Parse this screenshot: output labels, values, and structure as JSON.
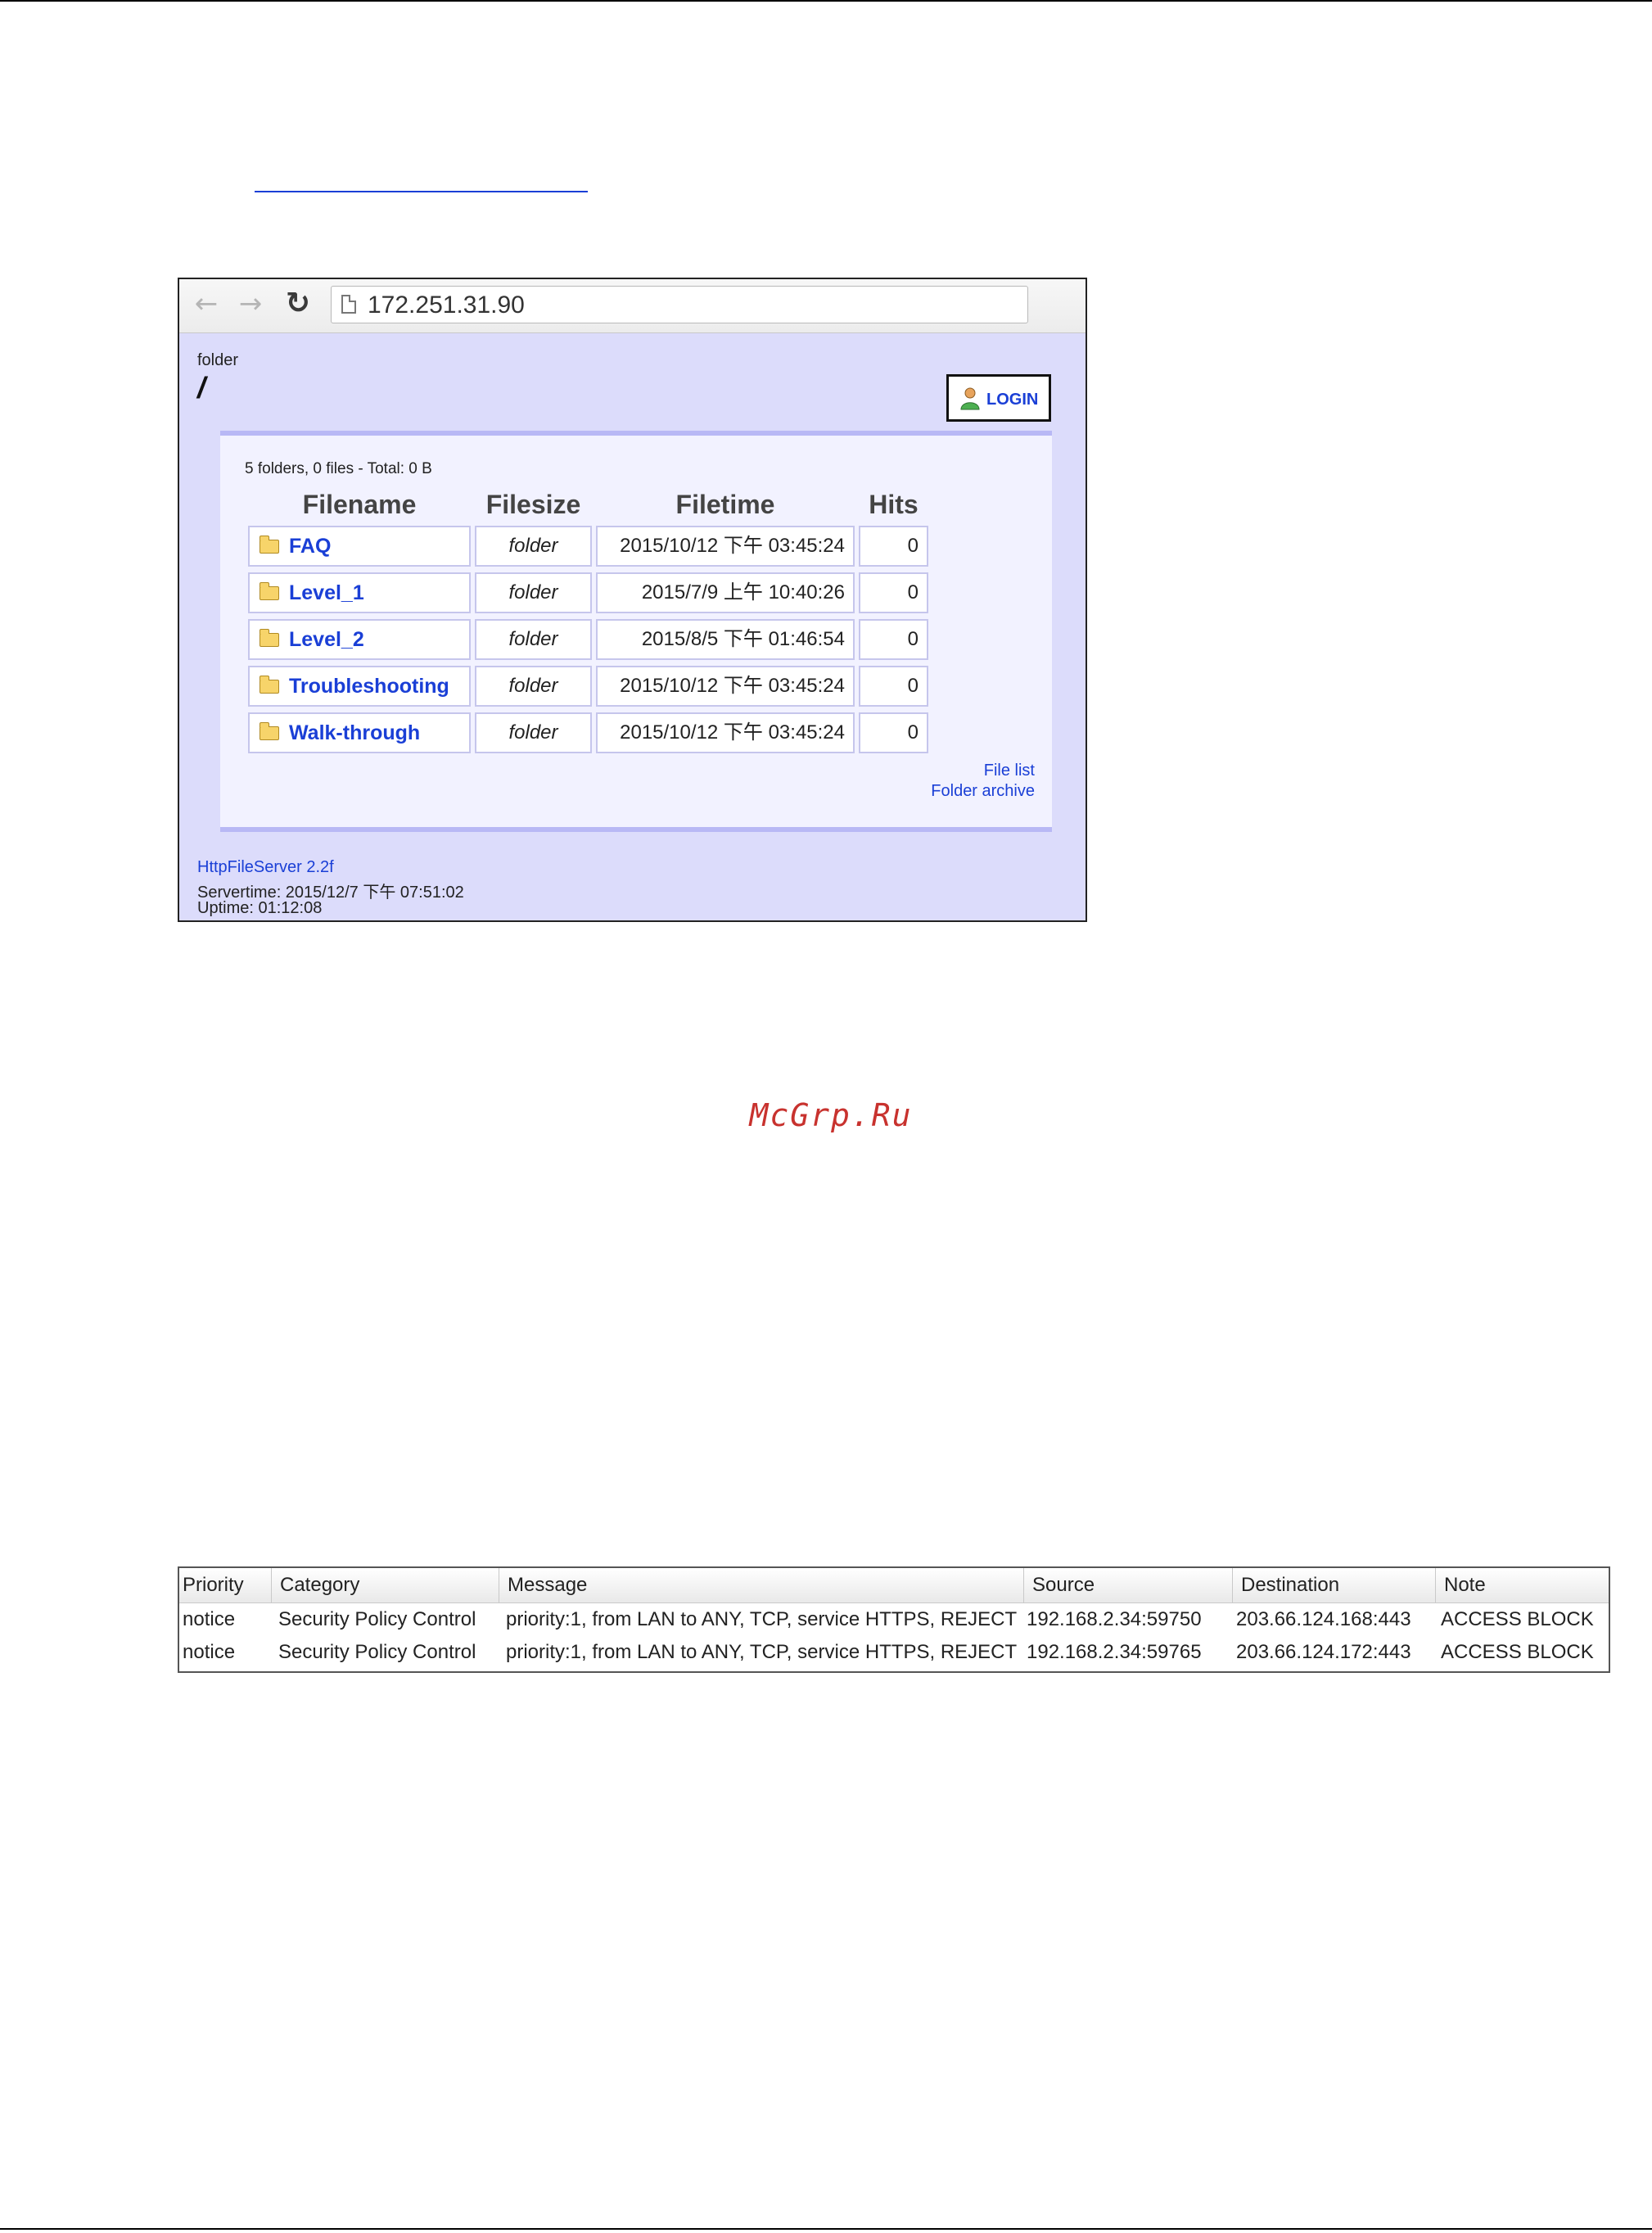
{
  "doc": {
    "watermark": "McGrp.Ru"
  },
  "browser": {
    "url": "172.251.31.90",
    "nav_back": "←",
    "nav_forward": "→",
    "reload": "↻"
  },
  "hfs": {
    "folder_label": "folder",
    "folder_path": "/",
    "login_label": "LOGIN",
    "summary": "5 folders, 0 files - Total: 0 B",
    "headers": [
      "Filename",
      "Filesize",
      "Filetime",
      "Hits"
    ],
    "rows": [
      {
        "name": "FAQ",
        "size": "folder",
        "time": "2015/10/12 下午 03:45:24",
        "hits": "0"
      },
      {
        "name": "Level_1",
        "size": "folder",
        "time": "2015/7/9 上午 10:40:26",
        "hits": "0"
      },
      {
        "name": "Level_2",
        "size": "folder",
        "time": "2015/8/5 下午 01:46:54",
        "hits": "0"
      },
      {
        "name": "Troubleshooting",
        "size": "folder",
        "time": "2015/10/12 下午 03:45:24",
        "hits": "0"
      },
      {
        "name": "Walk-through",
        "size": "folder",
        "time": "2015/10/12 下午 03:45:24",
        "hits": "0"
      }
    ],
    "file_list_link": "File list",
    "folder_archive_link": "Folder archive",
    "server_name": "HttpFileServer 2.2f",
    "servertime": "Servertime: 2015/12/7 下午 07:51:02",
    "uptime": "Uptime: 01:12:08",
    "accent_color": "#1a3fd6",
    "background_color": "#dcdcfb"
  },
  "log": {
    "headers": [
      "Priority",
      "Category",
      "Message",
      "Source",
      "Destination",
      "Note"
    ],
    "rows": [
      {
        "priority": "notice",
        "category": "Security Policy Control",
        "message": "priority:1, from LAN to ANY, TCP, service HTTPS, REJECT",
        "source": "192.168.2.34:59750",
        "destination": "203.66.124.168:443",
        "note": "ACCESS BLOCK"
      },
      {
        "priority": "notice",
        "category": "Security Policy Control",
        "message": "priority:1, from LAN to ANY, TCP, service HTTPS, REJECT",
        "source": "192.168.2.34:59765",
        "destination": "203.66.124.172:443",
        "note": "ACCESS BLOCK"
      }
    ]
  }
}
